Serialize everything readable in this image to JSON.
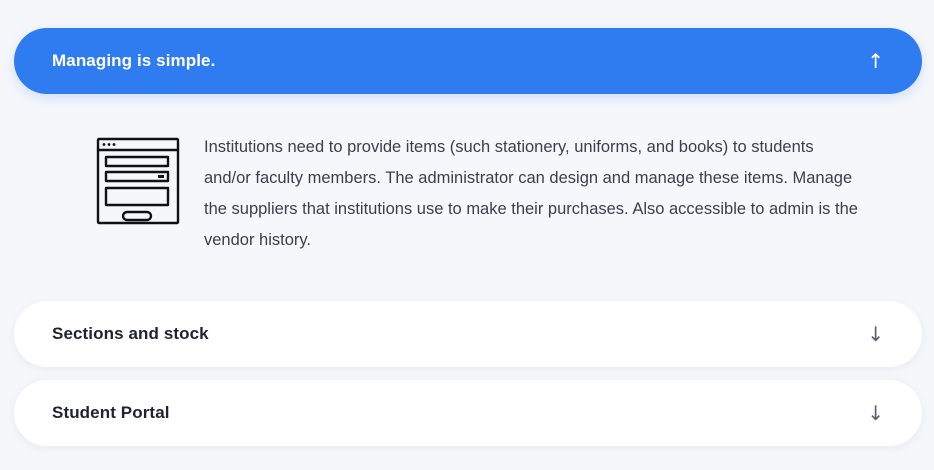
{
  "accordion": {
    "items": [
      {
        "title": "Managing is simple.",
        "expanded": true,
        "arrow": "↑",
        "arrow_icon": "arrow-up-icon",
        "icon": "form-window-icon",
        "body": "Institutions need to provide items (such stationery, uniforms, and books) to students and/or faculty members. The administrator can design and manage these items. Manage the suppliers that institutions use to make their purchases. Also accessible to admin is the vendor history."
      },
      {
        "title": "Sections and stock",
        "expanded": false,
        "arrow": "↓",
        "arrow_icon": "arrow-down-icon"
      },
      {
        "title": "Student Portal",
        "expanded": false,
        "arrow": "↓",
        "arrow_icon": "arrow-down-icon"
      }
    ]
  },
  "colors": {
    "accent": "#2f7bf0",
    "background": "#f5f7fb",
    "card": "#ffffff",
    "text": "#3a3f4a"
  }
}
